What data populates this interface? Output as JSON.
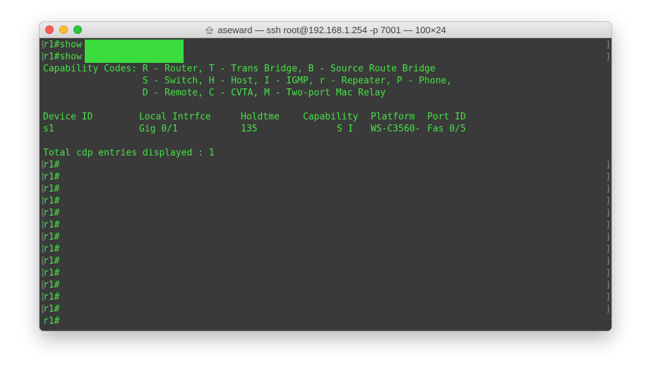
{
  "window": {
    "title": "aseward — ssh root@192.168.1.254 -p 7001 — 100×24",
    "title_icon": "home-icon"
  },
  "colors": {
    "terminal_bg": "#3a3a3a",
    "terminal_fg": "#46e246",
    "redaction": "#3adc3e"
  },
  "terminal": {
    "cmd1": "r1#show",
    "cmd2": "r1#show",
    "cap1": "Capability Codes: R - Router, T - Trans Bridge, B - Source Route Bridge",
    "cap2": "                  S - Switch, H - Host, I - IGMP, r - Repeater, P - Phone,",
    "cap3": "                  D - Remote, C - CVTA, M - Two-port Mac Relay",
    "headers": {
      "device_id": "Device ID",
      "local_intrfce": "Local Intrfce",
      "holdtme": "Holdtme",
      "capability": "Capability",
      "platform": "Platform",
      "port_id": "Port ID"
    },
    "row": {
      "device_id": "s1",
      "local_intrfce": "Gig 0/1",
      "holdtme": "135",
      "capability": "S I",
      "platform": "WS-C3560-",
      "port_id": "Fas 0/5"
    },
    "total": "Total cdp entries displayed : 1",
    "prompt": "r1#",
    "prompts": [
      "r1#",
      "r1#",
      "r1#",
      "r1#",
      "r1#",
      "r1#",
      "r1#",
      "r1#",
      "r1#",
      "r1#",
      "r1#",
      "r1#",
      "r1#"
    ],
    "final_prompt": "r1#"
  }
}
